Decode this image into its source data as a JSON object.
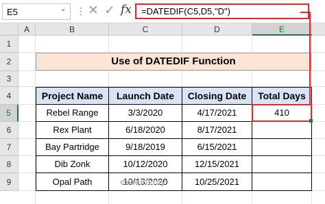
{
  "formula_bar": {
    "name_box": "E5",
    "name_box_arrow": "⌄",
    "more_dots": "⋮",
    "cancel_glyph": "✕",
    "enter_glyph": "✓",
    "fx_label": "fx",
    "formula": "=DATEDIF(C5,D5,\"D\")"
  },
  "columns": [
    "A",
    "B",
    "C",
    "D",
    "E"
  ],
  "rows": [
    "1",
    "2",
    "3",
    "4",
    "5",
    "6",
    "7",
    "8",
    "9"
  ],
  "title": "Use of DATEDIF Function",
  "table": {
    "headers": [
      "Project Name",
      "Launch Date",
      "Closing Date",
      "Total Days"
    ],
    "rows": [
      [
        "Rebel Range",
        "3/3/2020",
        "4/17/2021",
        "410"
      ],
      [
        "Rex Plant",
        "6/18/2020",
        "8/17/2021",
        ""
      ],
      [
        "Bay Partridge",
        "9/18/2019",
        "6/15/2021",
        ""
      ],
      [
        "Dib Zonk",
        "10/12/2020",
        "12/15/2021",
        ""
      ],
      [
        "Opal Path",
        "10/13/2020",
        "10/25/2021",
        ""
      ]
    ]
  },
  "watermark": "exceldemy",
  "colors": {
    "accent_red": "#e0282e",
    "title_fill": "#fce4d6",
    "header_fill": "#dae3f3"
  }
}
